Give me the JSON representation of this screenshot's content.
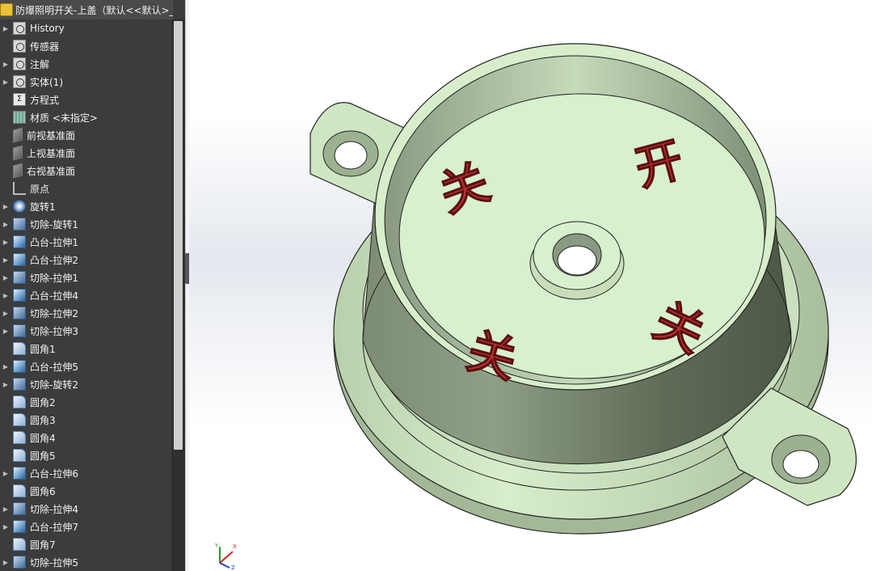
{
  "tree": {
    "title": "防爆照明开关-上盖（默认<<默认>_显",
    "items": [
      {
        "label": "History",
        "icon": "history-folder-icon",
        "expand": true,
        "kind": "folder"
      },
      {
        "label": "传感器",
        "icon": "sensors-folder-icon",
        "expand": false,
        "kind": "folder"
      },
      {
        "label": "注解",
        "icon": "annotations-folder-icon",
        "expand": true,
        "kind": "folder"
      },
      {
        "label": "实体(1)",
        "icon": "solid-bodies-folder-icon",
        "expand": true,
        "kind": "folder"
      },
      {
        "label": "方程式",
        "icon": "equations-icon",
        "expand": false,
        "kind": "eq"
      },
      {
        "label": "材质 <未指定>",
        "icon": "material-icon",
        "expand": false,
        "kind": "material"
      },
      {
        "label": "前视基准面",
        "icon": "plane-icon",
        "expand": false,
        "kind": "plane"
      },
      {
        "label": "上视基准面",
        "icon": "plane-icon",
        "expand": false,
        "kind": "plane"
      },
      {
        "label": "右视基准面",
        "icon": "plane-icon",
        "expand": false,
        "kind": "plane"
      },
      {
        "label": "原点",
        "icon": "origin-icon",
        "expand": false,
        "kind": "origin"
      },
      {
        "label": "旋转1",
        "icon": "revolve-icon",
        "expand": true,
        "kind": "revolve"
      },
      {
        "label": "切除-旋转1",
        "icon": "cut-revolve-icon",
        "expand": true,
        "kind": "cut"
      },
      {
        "label": "凸台-拉伸1",
        "icon": "boss-extrude-icon",
        "expand": true,
        "kind": "feature"
      },
      {
        "label": "凸台-拉伸2",
        "icon": "boss-extrude-icon",
        "expand": true,
        "kind": "feature"
      },
      {
        "label": "切除-拉伸1",
        "icon": "cut-extrude-icon",
        "expand": true,
        "kind": "cut"
      },
      {
        "label": "凸台-拉伸4",
        "icon": "boss-extrude-icon",
        "expand": true,
        "kind": "feature"
      },
      {
        "label": "切除-拉伸2",
        "icon": "cut-extrude-icon",
        "expand": true,
        "kind": "cut"
      },
      {
        "label": "切除-拉伸3",
        "icon": "cut-extrude-icon",
        "expand": true,
        "kind": "cut"
      },
      {
        "label": "圆角1",
        "icon": "fillet-icon",
        "expand": false,
        "kind": "fillet"
      },
      {
        "label": "凸台-拉伸5",
        "icon": "boss-extrude-icon",
        "expand": true,
        "kind": "feature"
      },
      {
        "label": "切除-旋转2",
        "icon": "cut-revolve-icon",
        "expand": true,
        "kind": "cut"
      },
      {
        "label": "圆角2",
        "icon": "fillet-icon",
        "expand": false,
        "kind": "fillet"
      },
      {
        "label": "圆角3",
        "icon": "fillet-icon",
        "expand": false,
        "kind": "fillet"
      },
      {
        "label": "圆角4",
        "icon": "fillet-icon",
        "expand": false,
        "kind": "fillet"
      },
      {
        "label": "圆角5",
        "icon": "fillet-icon",
        "expand": false,
        "kind": "fillet"
      },
      {
        "label": "凸台-拉伸6",
        "icon": "boss-extrude-icon",
        "expand": true,
        "kind": "feature"
      },
      {
        "label": "圆角6",
        "icon": "fillet-icon",
        "expand": false,
        "kind": "fillet"
      },
      {
        "label": "切除-拉伸4",
        "icon": "cut-extrude-icon",
        "expand": true,
        "kind": "cut"
      },
      {
        "label": "凸台-拉伸7",
        "icon": "boss-extrude-icon",
        "expand": true,
        "kind": "feature"
      },
      {
        "label": "圆角7",
        "icon": "fillet-icon",
        "expand": false,
        "kind": "fillet"
      },
      {
        "label": "切除-拉伸5",
        "icon": "cut-extrude-icon",
        "expand": true,
        "kind": "cut"
      }
    ]
  },
  "model": {
    "embossed_labels": [
      "关",
      "开",
      "关",
      "关"
    ],
    "part_color": "#d6efcc",
    "part_shadow_color": "#6f7f68",
    "text_color": "#c0302f"
  },
  "triad": {
    "x_label": "X",
    "y_label": "Y",
    "z_label": "Z"
  }
}
